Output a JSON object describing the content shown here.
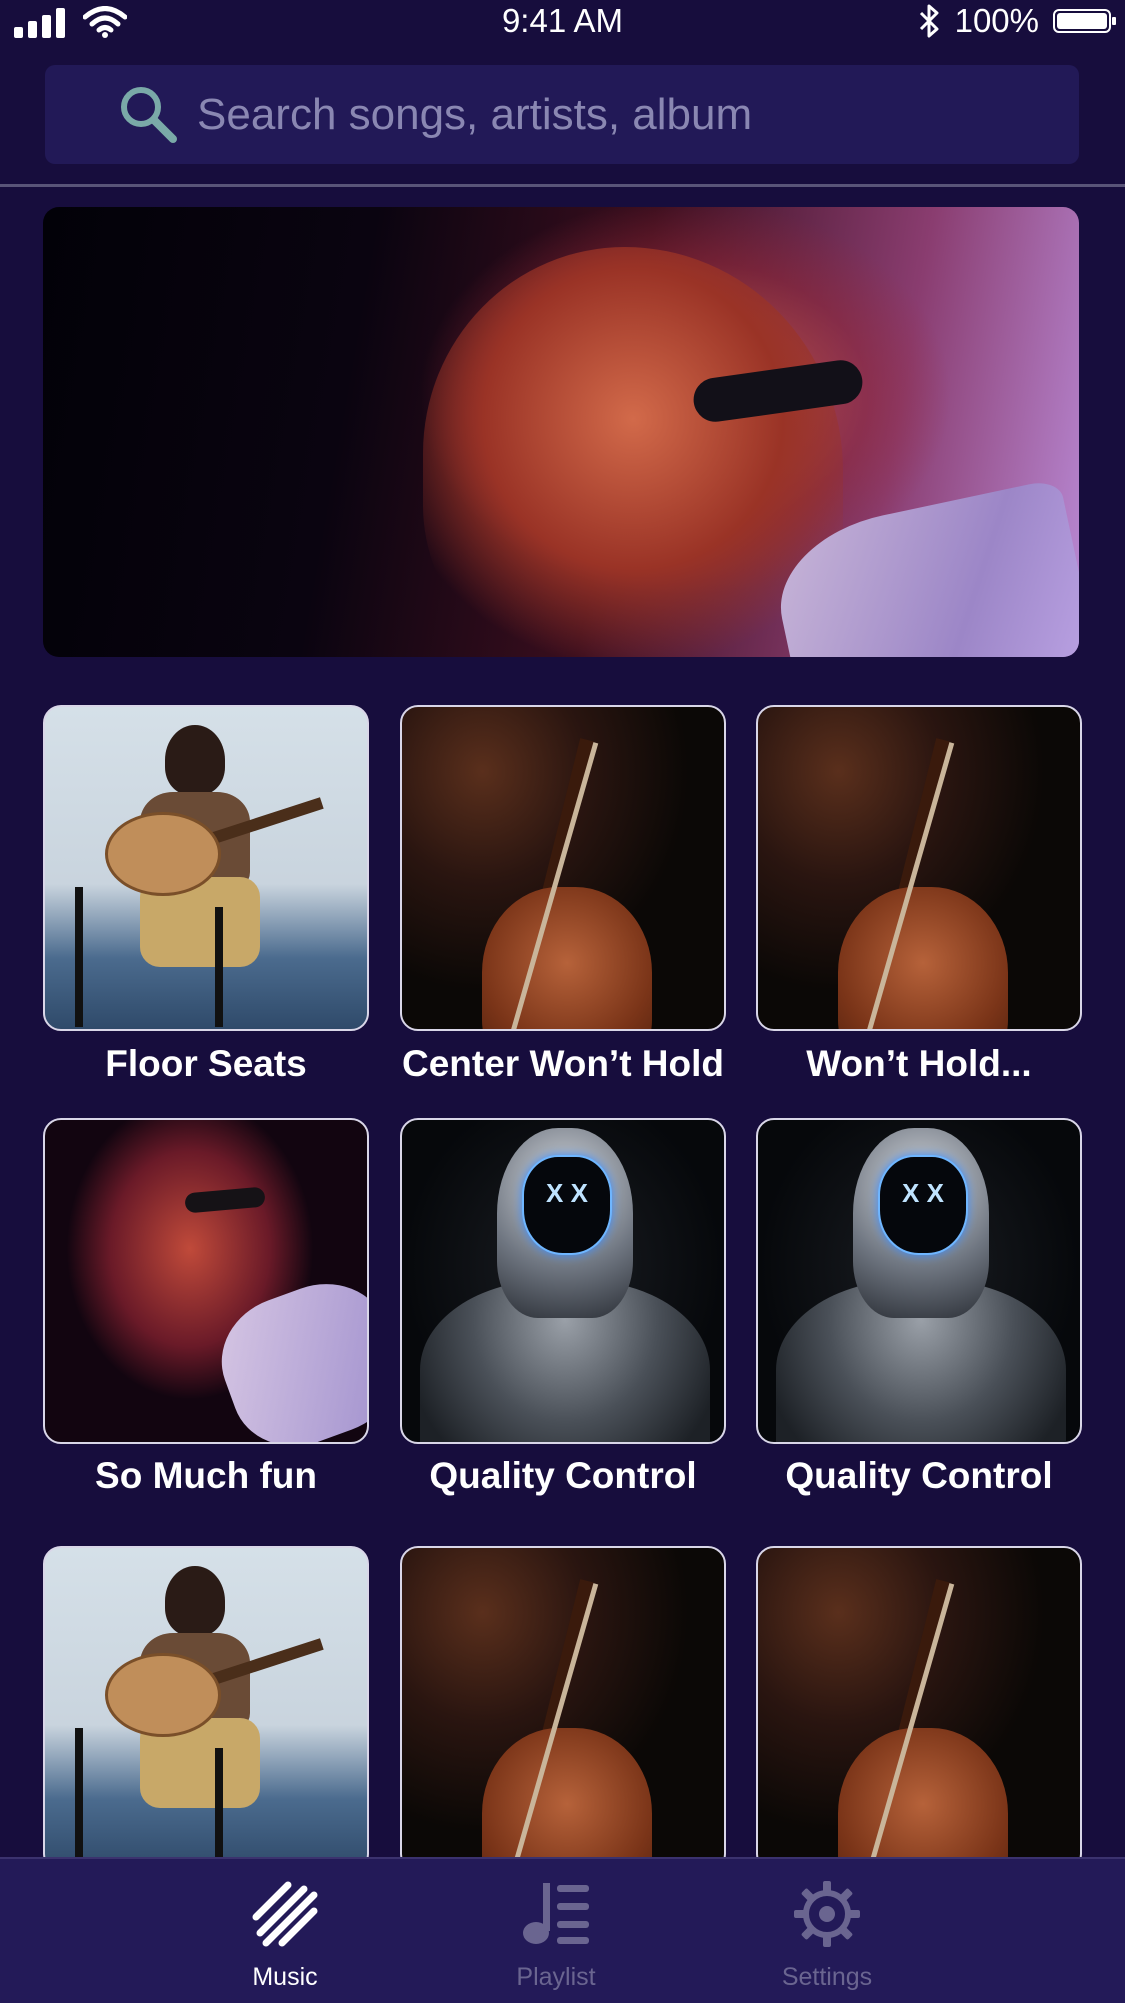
{
  "status_bar": {
    "time": "9:41 AM",
    "battery": "100%",
    "battery_level": 1.0,
    "icons": [
      "signal-icon",
      "wifi-icon",
      "bluetooth-icon",
      "battery-icon"
    ]
  },
  "search": {
    "placeholder": "Search songs, artists, album",
    "value": ""
  },
  "hero": {
    "image": "singer-with-microphone"
  },
  "albums": [
    {
      "title": "Floor Seats",
      "art": "guitar-girl"
    },
    {
      "title": "Center Won’t Hold",
      "art": "violin"
    },
    {
      "title": "Won’t Hold...",
      "art": "violin"
    },
    {
      "title": "So Much fun",
      "art": "singer"
    },
    {
      "title": "Quality Control",
      "art": "masked-hoodie"
    },
    {
      "title": "Quality Control",
      "art": "masked-hoodie"
    },
    {
      "title": "",
      "art": "guitar-girl"
    },
    {
      "title": "",
      "art": "violin"
    },
    {
      "title": "",
      "art": "violin"
    }
  ],
  "nav": {
    "items": [
      {
        "label": "Music",
        "icon": "music-icon",
        "active": true
      },
      {
        "label": "Playlist",
        "icon": "playlist-icon",
        "active": false
      },
      {
        "label": "Settings",
        "icon": "gear-icon",
        "active": false
      }
    ]
  },
  "colors": {
    "background": "#170d3d",
    "search_bg": "#221957",
    "nav_bg": "#231a58",
    "nav_inactive": "#6a6590",
    "text": "#ffffff"
  }
}
